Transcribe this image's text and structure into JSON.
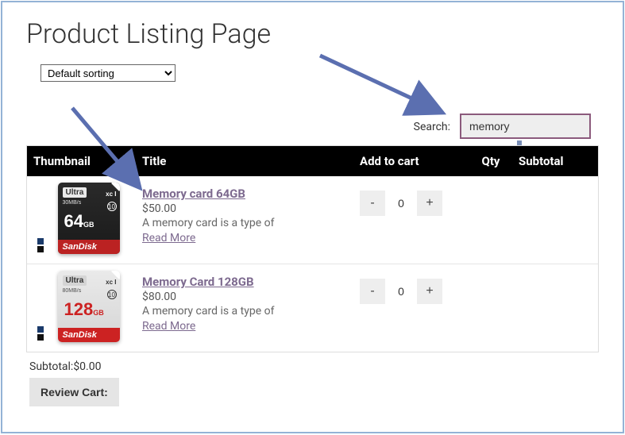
{
  "page_title": "Product Listing Page",
  "sort": {
    "selected": "Default sorting"
  },
  "search": {
    "label": "Search:",
    "value": "memory"
  },
  "table": {
    "headers": {
      "thumbnail": "Thumbnail",
      "title": "Title",
      "add_to_cart": "Add to cart",
      "qty": "Qty",
      "subtotal": "Subtotal"
    }
  },
  "products": [
    {
      "title": "Memory card 64GB",
      "price": "$50.00",
      "desc": "A memory card is a type of",
      "read_more": "Read More",
      "qty": "0",
      "capacity": "64",
      "ultra": "Ultra",
      "speed": "30MB/s",
      "xc": "xc I",
      "class": "10",
      "gb": "GB",
      "brand": "SanDisk"
    },
    {
      "title": "Memory Card 128GB",
      "price": "$80.00",
      "desc": "A memory card is a type of",
      "read_more": "Read More",
      "qty": "0",
      "capacity": "128",
      "ultra": "Ultra",
      "speed": "80MB/s",
      "xc": "xc I",
      "class": "10",
      "gb": "GB",
      "brand": "SanDisk"
    }
  ],
  "qty_controls": {
    "minus": "-",
    "plus": "+"
  },
  "footer": {
    "subtotal_label": "Subtotal:",
    "subtotal_value": "$0.00",
    "review_cart": "Review Cart:"
  }
}
